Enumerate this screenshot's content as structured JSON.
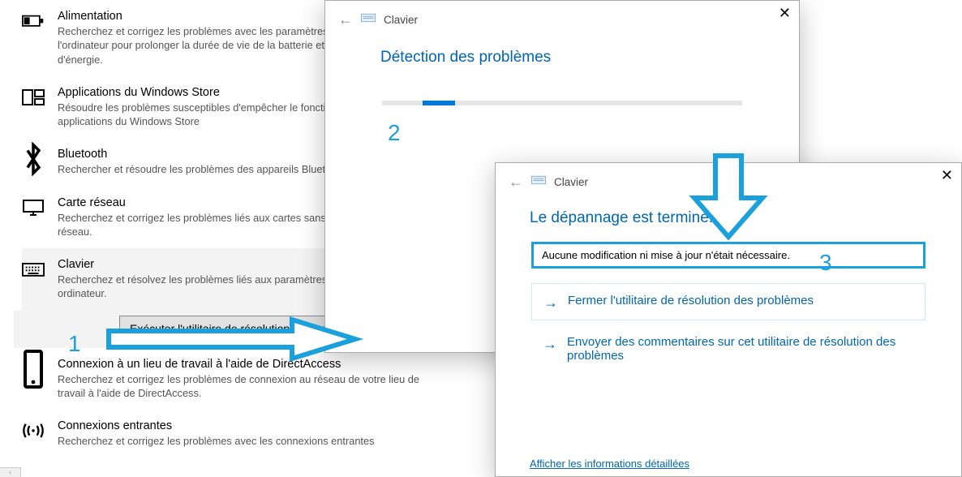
{
  "troubleshoot": {
    "items": [
      {
        "title": "Alimentation",
        "desc": "Recherchez et corrigez les problèmes avec les paramètres d'alimentation de l'ordinateur pour prolonger la durée de vie de la batterie et réduire la consommation d'énergie."
      },
      {
        "title": "Applications du Windows Store",
        "desc": "Résoudre les problèmes susceptibles d'empêcher le fonctionnement correct des applications du Windows Store"
      },
      {
        "title": "Bluetooth",
        "desc": "Rechercher et résoudre les problèmes des appareils Bluetooth"
      },
      {
        "title": "Carte réseau",
        "desc": "Recherchez et corrigez les problèmes liés aux cartes sans fil et aux autres cartes réseau."
      },
      {
        "title": "Clavier",
        "desc": "Recherchez et résolvez les problèmes liés aux paramètres du clavier de votre ordinateur."
      },
      {
        "title": "Connexion à un lieu de travail à l'aide de DirectAccess",
        "desc": "Recherchez et corrigez les problèmes de connexion au réseau de votre lieu de travail à l'aide de DirectAccess."
      },
      {
        "title": "Connexions entrantes",
        "desc": "Recherchez et corrigez les problèmes avec les connexions entrantes"
      }
    ],
    "run_button": "Exécuter l'utilitaire de résolution des problèmes"
  },
  "modal2": {
    "crumb": "Clavier",
    "headline": "Détection des problèmes"
  },
  "modal3": {
    "crumb": "Clavier",
    "headline": "Le dépannage est terminé.",
    "result_msg": "Aucune modification ni mise à jour n'était nécessaire.",
    "opt_close": "Fermer l'utilitaire de résolution des problèmes",
    "opt_feedback": "Envoyer des commentaires sur cet utilitaire de résolution des problèmes",
    "footer_link": "Afficher les informations détaillées"
  },
  "annotations": {
    "n1": "1",
    "n2": "2",
    "n3": "3"
  }
}
